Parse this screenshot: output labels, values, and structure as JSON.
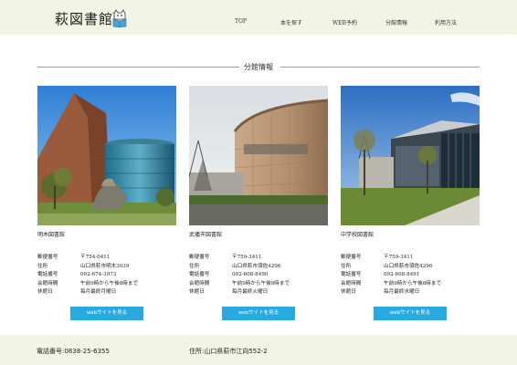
{
  "header": {
    "logo_text": "萩図書館",
    "logo_icon": "cat-reading-book-icon",
    "nav": [
      "TOP",
      "本を探す",
      "WEB予約",
      "分館情報",
      "利用方法"
    ]
  },
  "section": {
    "title": "分館情報"
  },
  "branches": [
    {
      "name": "明木図書館",
      "info": [
        {
          "label": "郵便番号",
          "value": "〒754-0411"
        },
        {
          "label": "住所",
          "value": "山口県萩市明木3039"
        },
        {
          "label": "電話番号",
          "value": "092-674-3973"
        },
        {
          "label": "会館時間",
          "value": "午前9時から午後8時まで"
        },
        {
          "label": "休館日",
          "value": "毎月最終月曜日"
        }
      ],
      "button": "webサイトを見る"
    },
    {
      "name": "武播市図書館",
      "info": [
        {
          "label": "郵便番号",
          "value": "〒759-3411"
        },
        {
          "label": "住所",
          "value": "山口県萩市須佐4296"
        },
        {
          "label": "電話番号",
          "value": "092-608-8490"
        },
        {
          "label": "会館時間",
          "value": "午前9時から午後8時まで"
        },
        {
          "label": "休館日",
          "value": "毎月最終火曜日"
        }
      ],
      "button": "webサイトを見る"
    },
    {
      "name": "中学校図書館",
      "info": [
        {
          "label": "郵便番号",
          "value": "〒759-3411"
        },
        {
          "label": "住所",
          "value": "山口県萩市須佐4296"
        },
        {
          "label": "電話番号",
          "value": "092-608-8491"
        },
        {
          "label": "会館時間",
          "value": "午前9時から午後8時まで"
        },
        {
          "label": "休館日",
          "value": "毎月最終水曜日"
        }
      ],
      "button": "webサイトを見る"
    }
  ],
  "footer": {
    "tel": "電話番号:0838-25-6355",
    "address": "住所:山口県萩市江向552-2"
  },
  "colors": {
    "header_bg": "#f2f5e6",
    "button": "#27a9e1",
    "footer_bg": "#f2f5e6"
  }
}
